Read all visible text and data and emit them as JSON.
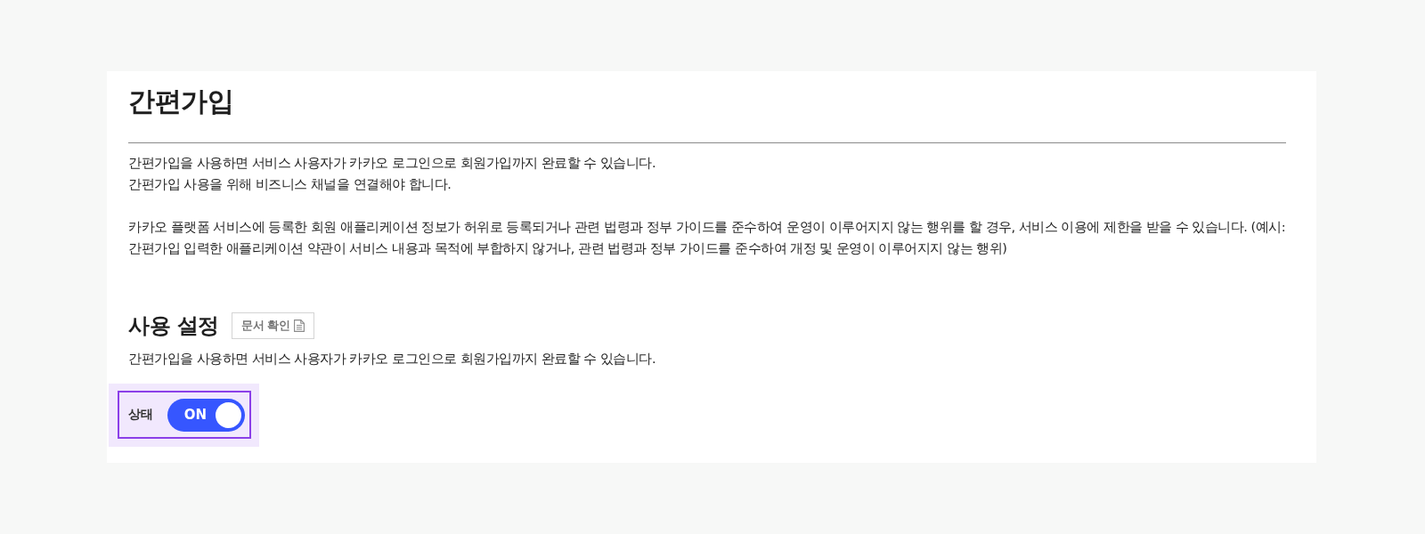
{
  "page": {
    "title": "간편가입",
    "intro": [
      "간편가입을 사용하면 서비스 사용자가 카카오 로그인으로 회원가입까지 완료할 수 있습니다.",
      "간편가입 사용을 위해 비즈니스 채널을 연결해야 합니다."
    ],
    "notice": "카카오 플랫폼 서비스에 등록한 회원 애플리케이션 정보가 허위로 등록되거나 관련 법령과 정부 가이드를 준수하여 운영이 이루어지지 않는 행위를 할 경우, 서비스 이용에 제한을 받을 수 있습니다. (예시: 간편가입 입력한 애플리케이션 약관이 서비스 내용과 목적에 부합하지 않거나, 관련 법령과 정부 가이드를 준수하여 개정 및 운영이 이루어지지 않는 행위)"
  },
  "settings": {
    "heading": "사용 설정",
    "doc_button": "문서 확인",
    "description": "간편가입을 사용하면 서비스 사용자가 카카오 로그인으로 회원가입까지 완료할 수 있습니다.",
    "status": {
      "label": "상태",
      "toggle_text": "ON",
      "on": true
    }
  }
}
